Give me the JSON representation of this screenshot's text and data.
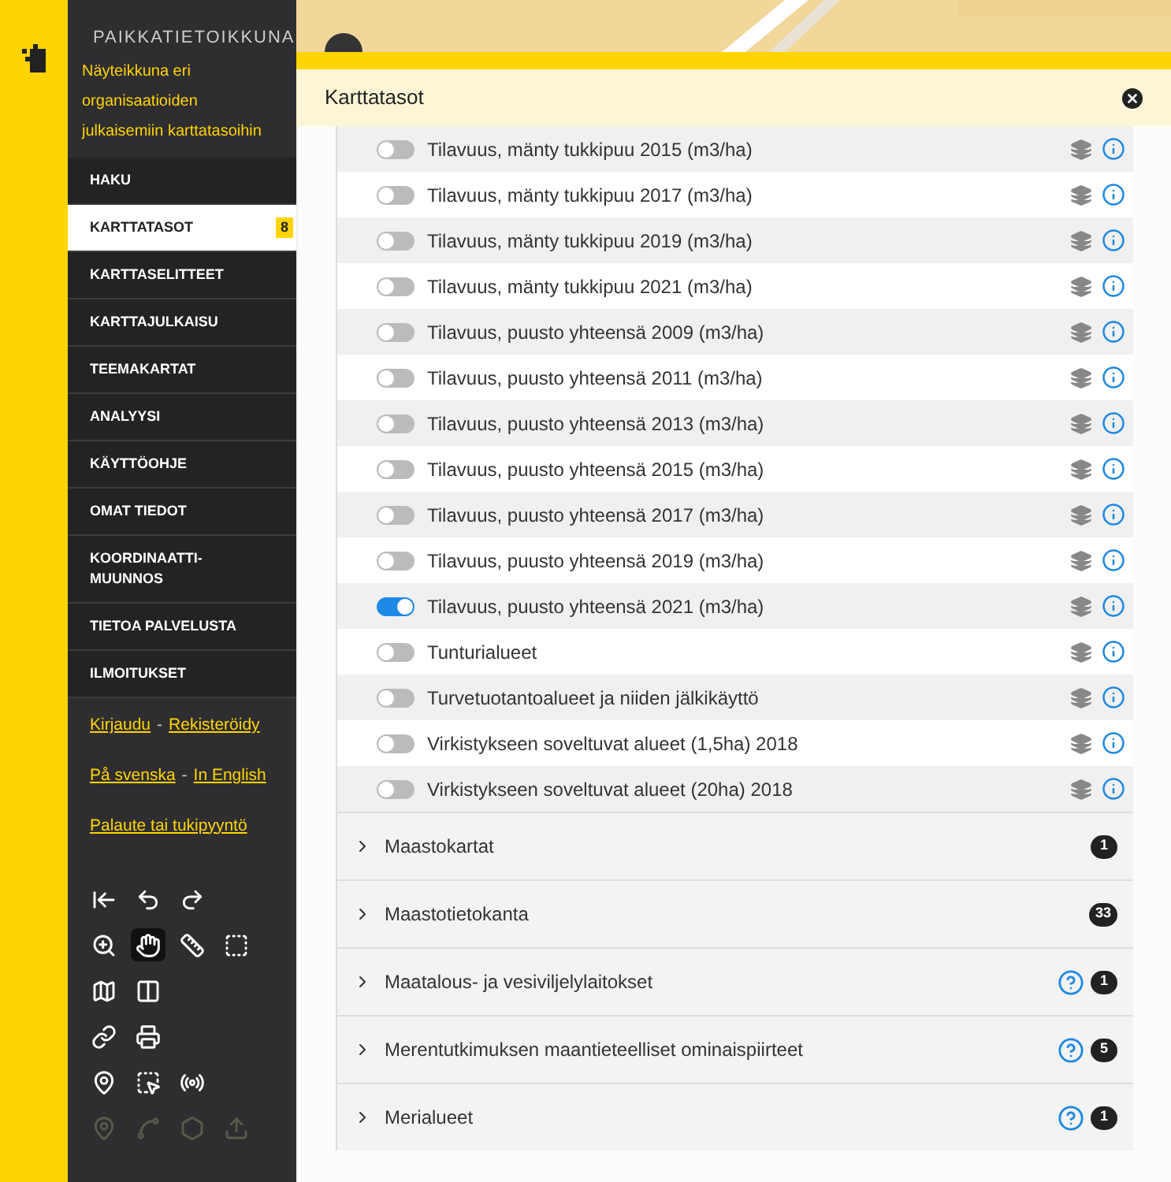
{
  "sidebar": {
    "title": "PAIKKATIETOIKKUNA",
    "description": "Näyteikkuna eri organisaatioiden julkaisemiin karttatasoihin",
    "menu": [
      {
        "label": "HAKU",
        "selected": false
      },
      {
        "label": "KARTTATASOT",
        "selected": true,
        "badge": "8"
      },
      {
        "label": "KARTTASELITTEET",
        "selected": false
      },
      {
        "label": "KARTTAJULKAISU",
        "selected": false
      },
      {
        "label": "TEEMAKARTAT",
        "selected": false
      },
      {
        "label": "ANALYYSI",
        "selected": false
      },
      {
        "label": "KÄYTTÖOHJE",
        "selected": false
      },
      {
        "label": "OMAT TIEDOT",
        "selected": false
      },
      {
        "label": "KOORDINAATTI-MUUNNOS",
        "selected": false
      },
      {
        "label": "TIETOA PALVELUSTA",
        "selected": false
      },
      {
        "label": "ILMOITUKSET",
        "selected": false
      }
    ],
    "link_rows": [
      {
        "items": [
          {
            "kind": "link",
            "text": "Kirjaudu"
          },
          {
            "kind": "separator",
            "text": "-"
          },
          {
            "kind": "link",
            "text": "Rekisteröidy"
          }
        ]
      },
      {
        "items": [
          {
            "kind": "link",
            "text": "På svenska"
          },
          {
            "kind": "separator",
            "text": "-"
          },
          {
            "kind": "link",
            "text": "In English"
          }
        ]
      },
      {
        "items": [
          {
            "kind": "link",
            "text": "Palaute tai tukipyyntö"
          }
        ]
      }
    ],
    "tool_rows": [
      [
        {
          "kind": "reset",
          "selected": false,
          "disabled": false
        },
        {
          "kind": "undo",
          "selected": false,
          "disabled": false
        },
        {
          "kind": "redo",
          "selected": false,
          "disabled": false
        }
      ],
      [
        {
          "kind": "zoom",
          "selected": false,
          "disabled": false
        },
        {
          "kind": "pan",
          "selected": true,
          "disabled": false
        },
        {
          "kind": "measure-line",
          "selected": false,
          "disabled": false
        },
        {
          "kind": "measure-area",
          "selected": false,
          "disabled": false
        }
      ],
      [
        {
          "kind": "map",
          "selected": false,
          "disabled": false
        },
        {
          "kind": "split",
          "selected": false,
          "disabled": false
        }
      ],
      [
        {
          "kind": "link",
          "selected": false,
          "disabled": false
        },
        {
          "kind": "print",
          "selected": false,
          "disabled": false
        }
      ],
      [
        {
          "kind": "pin",
          "selected": false,
          "disabled": false
        },
        {
          "kind": "select",
          "selected": false,
          "disabled": false
        },
        {
          "kind": "signal",
          "selected": false,
          "disabled": false
        }
      ],
      [
        {
          "kind": "pin",
          "selected": false,
          "disabled": true
        },
        {
          "kind": "line",
          "selected": false,
          "disabled": true
        },
        {
          "kind": "area",
          "selected": false,
          "disabled": true
        },
        {
          "kind": "upload",
          "selected": false,
          "disabled": true
        }
      ]
    ]
  },
  "panel": {
    "title": "Karttatasot",
    "layers": [
      {
        "name": "Tilavuus, mänty tukkipuu 2015 (m3/ha)",
        "on": false
      },
      {
        "name": "Tilavuus, mänty tukkipuu 2017 (m3/ha)",
        "on": false
      },
      {
        "name": "Tilavuus, mänty tukkipuu 2019 (m3/ha)",
        "on": false
      },
      {
        "name": "Tilavuus, mänty tukkipuu 2021 (m3/ha)",
        "on": false
      },
      {
        "name": "Tilavuus, puusto yhteensä 2009 (m3/ha)",
        "on": false
      },
      {
        "name": "Tilavuus, puusto yhteensä 2011 (m3/ha)",
        "on": false
      },
      {
        "name": "Tilavuus, puusto yhteensä 2013 (m3/ha)",
        "on": false
      },
      {
        "name": "Tilavuus, puusto yhteensä 2015 (m3/ha)",
        "on": false
      },
      {
        "name": "Tilavuus, puusto yhteensä 2017 (m3/ha)",
        "on": false
      },
      {
        "name": "Tilavuus, puusto yhteensä 2019 (m3/ha)",
        "on": false
      },
      {
        "name": "Tilavuus, puusto yhteensä 2021 (m3/ha)",
        "on": true
      },
      {
        "name": "Tunturialueet",
        "on": false
      },
      {
        "name": "Turvetuotantoalueet ja niiden jälkikäyttö",
        "on": false
      },
      {
        "name": "Virkistykseen soveltuvat alueet (1,5ha) 2018",
        "on": false
      },
      {
        "name": "Virkistykseen soveltuvat alueet (20ha) 2018",
        "on": false
      }
    ],
    "groups": [
      {
        "name": "Maastokartat",
        "count": "1",
        "help": false
      },
      {
        "name": "Maastotietokanta",
        "count": "33",
        "help": false
      },
      {
        "name": "Maatalous- ja vesiviljelylaitokset",
        "count": "1",
        "help": true
      },
      {
        "name": "Merentutkimuksen maantieteelliset ominaispiirteet",
        "count": "5",
        "help": true
      },
      {
        "name": "Merialueet",
        "count": "1",
        "help": true
      }
    ]
  }
}
